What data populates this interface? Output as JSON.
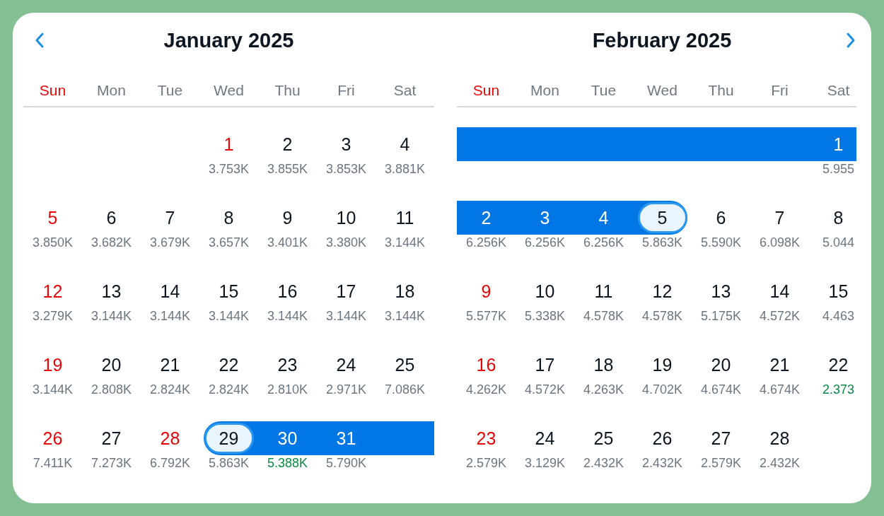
{
  "months": [
    {
      "title": "January 2025",
      "weekdays": [
        {
          "label": "Sun",
          "highlighted": true
        },
        {
          "label": "Mon",
          "highlighted": false
        },
        {
          "label": "Tue",
          "highlighted": false
        },
        {
          "label": "Wed",
          "highlighted": false
        },
        {
          "label": "Thu",
          "highlighted": false
        },
        {
          "label": "Fri",
          "highlighted": false
        },
        {
          "label": "Sat",
          "highlighted": false
        }
      ],
      "days": [
        {
          "kind": "blank",
          "in_range": false
        },
        {
          "kind": "blank",
          "in_range": false
        },
        {
          "kind": "blank",
          "in_range": false
        },
        {
          "kind": "day",
          "day": "1",
          "price": "3.753K",
          "holiday": true,
          "low_price": false,
          "in_range": false,
          "selected": false
        },
        {
          "kind": "day",
          "day": "2",
          "price": "3.855K",
          "holiday": false,
          "low_price": false,
          "in_range": false,
          "selected": false
        },
        {
          "kind": "day",
          "day": "3",
          "price": "3.853K",
          "holiday": false,
          "low_price": false,
          "in_range": false,
          "selected": false
        },
        {
          "kind": "day",
          "day": "4",
          "price": "3.881K",
          "holiday": false,
          "low_price": false,
          "in_range": false,
          "selected": false
        },
        {
          "kind": "day",
          "day": "5",
          "price": "3.850K",
          "holiday": true,
          "low_price": false,
          "in_range": false,
          "selected": false
        },
        {
          "kind": "day",
          "day": "6",
          "price": "3.682K",
          "holiday": false,
          "low_price": false,
          "in_range": false,
          "selected": false
        },
        {
          "kind": "day",
          "day": "7",
          "price": "3.679K",
          "holiday": false,
          "low_price": false,
          "in_range": false,
          "selected": false
        },
        {
          "kind": "day",
          "day": "8",
          "price": "3.657K",
          "holiday": false,
          "low_price": false,
          "in_range": false,
          "selected": false
        },
        {
          "kind": "day",
          "day": "9",
          "price": "3.401K",
          "holiday": false,
          "low_price": false,
          "in_range": false,
          "selected": false
        },
        {
          "kind": "day",
          "day": "10",
          "price": "3.380K",
          "holiday": false,
          "low_price": false,
          "in_range": false,
          "selected": false
        },
        {
          "kind": "day",
          "day": "11",
          "price": "3.144K",
          "holiday": false,
          "low_price": false,
          "in_range": false,
          "selected": false
        },
        {
          "kind": "day",
          "day": "12",
          "price": "3.279K",
          "holiday": true,
          "low_price": false,
          "in_range": false,
          "selected": false
        },
        {
          "kind": "day",
          "day": "13",
          "price": "3.144K",
          "holiday": false,
          "low_price": false,
          "in_range": false,
          "selected": false
        },
        {
          "kind": "day",
          "day": "14",
          "price": "3.144K",
          "holiday": false,
          "low_price": false,
          "in_range": false,
          "selected": false
        },
        {
          "kind": "day",
          "day": "15",
          "price": "3.144K",
          "holiday": false,
          "low_price": false,
          "in_range": false,
          "selected": false
        },
        {
          "kind": "day",
          "day": "16",
          "price": "3.144K",
          "holiday": false,
          "low_price": false,
          "in_range": false,
          "selected": false
        },
        {
          "kind": "day",
          "day": "17",
          "price": "3.144K",
          "holiday": false,
          "low_price": false,
          "in_range": false,
          "selected": false
        },
        {
          "kind": "day",
          "day": "18",
          "price": "3.144K",
          "holiday": false,
          "low_price": false,
          "in_range": false,
          "selected": false
        },
        {
          "kind": "day",
          "day": "19",
          "price": "3.144K",
          "holiday": true,
          "low_price": false,
          "in_range": false,
          "selected": false
        },
        {
          "kind": "day",
          "day": "20",
          "price": "2.808K",
          "holiday": false,
          "low_price": false,
          "in_range": false,
          "selected": false
        },
        {
          "kind": "day",
          "day": "21",
          "price": "2.824K",
          "holiday": false,
          "low_price": false,
          "in_range": false,
          "selected": false
        },
        {
          "kind": "day",
          "day": "22",
          "price": "2.824K",
          "holiday": false,
          "low_price": false,
          "in_range": false,
          "selected": false
        },
        {
          "kind": "day",
          "day": "23",
          "price": "2.810K",
          "holiday": false,
          "low_price": false,
          "in_range": false,
          "selected": false
        },
        {
          "kind": "day",
          "day": "24",
          "price": "2.971K",
          "holiday": false,
          "low_price": false,
          "in_range": false,
          "selected": false
        },
        {
          "kind": "day",
          "day": "25",
          "price": "7.086K",
          "holiday": false,
          "low_price": false,
          "in_range": false,
          "selected": false
        },
        {
          "kind": "day",
          "day": "26",
          "price": "7.411K",
          "holiday": true,
          "low_price": false,
          "in_range": false,
          "selected": false
        },
        {
          "kind": "day",
          "day": "27",
          "price": "7.273K",
          "holiday": false,
          "low_price": false,
          "in_range": false,
          "selected": false
        },
        {
          "kind": "day",
          "day": "28",
          "price": "6.792K",
          "holiday": true,
          "low_price": false,
          "in_range": false,
          "selected": false
        },
        {
          "kind": "day",
          "day": "29",
          "price": "5.863K",
          "holiday": false,
          "low_price": false,
          "in_range": true,
          "selected": true
        },
        {
          "kind": "day",
          "day": "30",
          "price": "5.388K",
          "holiday": false,
          "low_price": true,
          "in_range": true,
          "selected": false
        },
        {
          "kind": "day",
          "day": "31",
          "price": "5.790K",
          "holiday": false,
          "low_price": false,
          "in_range": true,
          "selected": false
        },
        {
          "kind": "blank",
          "in_range": true
        }
      ]
    },
    {
      "title": "February 2025",
      "weekdays": [
        {
          "label": "Sun",
          "highlighted": true
        },
        {
          "label": "Mon",
          "highlighted": false
        },
        {
          "label": "Tue",
          "highlighted": false
        },
        {
          "label": "Wed",
          "highlighted": false
        },
        {
          "label": "Thu",
          "highlighted": false
        },
        {
          "label": "Fri",
          "highlighted": false
        },
        {
          "label": "Sat",
          "highlighted": false
        }
      ],
      "days": [
        {
          "kind": "blank",
          "in_range": true
        },
        {
          "kind": "blank",
          "in_range": true
        },
        {
          "kind": "blank",
          "in_range": true
        },
        {
          "kind": "blank",
          "in_range": true
        },
        {
          "kind": "blank",
          "in_range": true
        },
        {
          "kind": "blank",
          "in_range": true
        },
        {
          "kind": "day",
          "day": "1",
          "price": "5.955",
          "holiday": false,
          "low_price": false,
          "in_range": true,
          "selected": false
        },
        {
          "kind": "day",
          "day": "2",
          "price": "6.256K",
          "holiday": false,
          "low_price": false,
          "in_range": true,
          "selected": false
        },
        {
          "kind": "day",
          "day": "3",
          "price": "6.256K",
          "holiday": false,
          "low_price": false,
          "in_range": true,
          "selected": false
        },
        {
          "kind": "day",
          "day": "4",
          "price": "6.256K",
          "holiday": false,
          "low_price": false,
          "in_range": true,
          "selected": false
        },
        {
          "kind": "day",
          "day": "5",
          "price": "5.863K",
          "holiday": false,
          "low_price": false,
          "in_range": true,
          "selected": true
        },
        {
          "kind": "day",
          "day": "6",
          "price": "5.590K",
          "holiday": false,
          "low_price": false,
          "in_range": false,
          "selected": false
        },
        {
          "kind": "day",
          "day": "7",
          "price": "6.098K",
          "holiday": false,
          "low_price": false,
          "in_range": false,
          "selected": false
        },
        {
          "kind": "day",
          "day": "8",
          "price": "5.044",
          "holiday": false,
          "low_price": false,
          "in_range": false,
          "selected": false
        },
        {
          "kind": "day",
          "day": "9",
          "price": "5.577K",
          "holiday": true,
          "low_price": false,
          "in_range": false,
          "selected": false
        },
        {
          "kind": "day",
          "day": "10",
          "price": "5.338K",
          "holiday": false,
          "low_price": false,
          "in_range": false,
          "selected": false
        },
        {
          "kind": "day",
          "day": "11",
          "price": "4.578K",
          "holiday": false,
          "low_price": false,
          "in_range": false,
          "selected": false
        },
        {
          "kind": "day",
          "day": "12",
          "price": "4.578K",
          "holiday": false,
          "low_price": false,
          "in_range": false,
          "selected": false
        },
        {
          "kind": "day",
          "day": "13",
          "price": "5.175K",
          "holiday": false,
          "low_price": false,
          "in_range": false,
          "selected": false
        },
        {
          "kind": "day",
          "day": "14",
          "price": "4.572K",
          "holiday": false,
          "low_price": false,
          "in_range": false,
          "selected": false
        },
        {
          "kind": "day",
          "day": "15",
          "price": "4.463",
          "holiday": false,
          "low_price": false,
          "in_range": false,
          "selected": false
        },
        {
          "kind": "day",
          "day": "16",
          "price": "4.262K",
          "holiday": true,
          "low_price": false,
          "in_range": false,
          "selected": false
        },
        {
          "kind": "day",
          "day": "17",
          "price": "4.572K",
          "holiday": false,
          "low_price": false,
          "in_range": false,
          "selected": false
        },
        {
          "kind": "day",
          "day": "18",
          "price": "4.263K",
          "holiday": false,
          "low_price": false,
          "in_range": false,
          "selected": false
        },
        {
          "kind": "day",
          "day": "19",
          "price": "4.702K",
          "holiday": false,
          "low_price": false,
          "in_range": false,
          "selected": false
        },
        {
          "kind": "day",
          "day": "20",
          "price": "4.674K",
          "holiday": false,
          "low_price": false,
          "in_range": false,
          "selected": false
        },
        {
          "kind": "day",
          "day": "21",
          "price": "4.674K",
          "holiday": false,
          "low_price": false,
          "in_range": false,
          "selected": false
        },
        {
          "kind": "day",
          "day": "22",
          "price": "2.373",
          "holiday": false,
          "low_price": true,
          "in_range": false,
          "selected": false
        },
        {
          "kind": "day",
          "day": "23",
          "price": "2.579K",
          "holiday": true,
          "low_price": false,
          "in_range": false,
          "selected": false
        },
        {
          "kind": "day",
          "day": "24",
          "price": "3.129K",
          "holiday": false,
          "low_price": false,
          "in_range": false,
          "selected": false
        },
        {
          "kind": "day",
          "day": "25",
          "price": "2.432K",
          "holiday": false,
          "low_price": false,
          "in_range": false,
          "selected": false
        },
        {
          "kind": "day",
          "day": "26",
          "price": "2.432K",
          "holiday": false,
          "low_price": false,
          "in_range": false,
          "selected": false
        },
        {
          "kind": "day",
          "day": "27",
          "price": "2.579K",
          "holiday": false,
          "low_price": false,
          "in_range": false,
          "selected": false
        },
        {
          "kind": "day",
          "day": "28",
          "price": "2.432K",
          "holiday": false,
          "low_price": false,
          "in_range": false,
          "selected": false
        }
      ]
    }
  ]
}
